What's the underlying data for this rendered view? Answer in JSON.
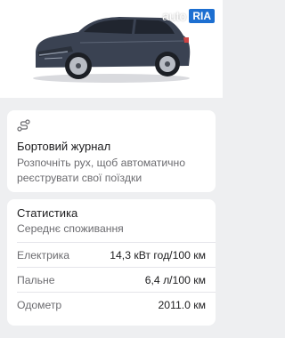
{
  "watermark": {
    "left": "auto",
    "right": "RIA"
  },
  "journal": {
    "icon": "route-icon",
    "title": "Бортовий журнал",
    "description": "Розпочніть рух, щоб автоматично реєструвати свої поїздки"
  },
  "stats": {
    "title": "Статистика",
    "subtitle": "Середнє споживання",
    "rows": [
      {
        "label": "Електрика",
        "value": "14,3 кВт год/100 км"
      },
      {
        "label": "Пальне",
        "value": "6,4 л/100 км"
      },
      {
        "label": "Одометр",
        "value": "2011.0 км"
      }
    ]
  }
}
